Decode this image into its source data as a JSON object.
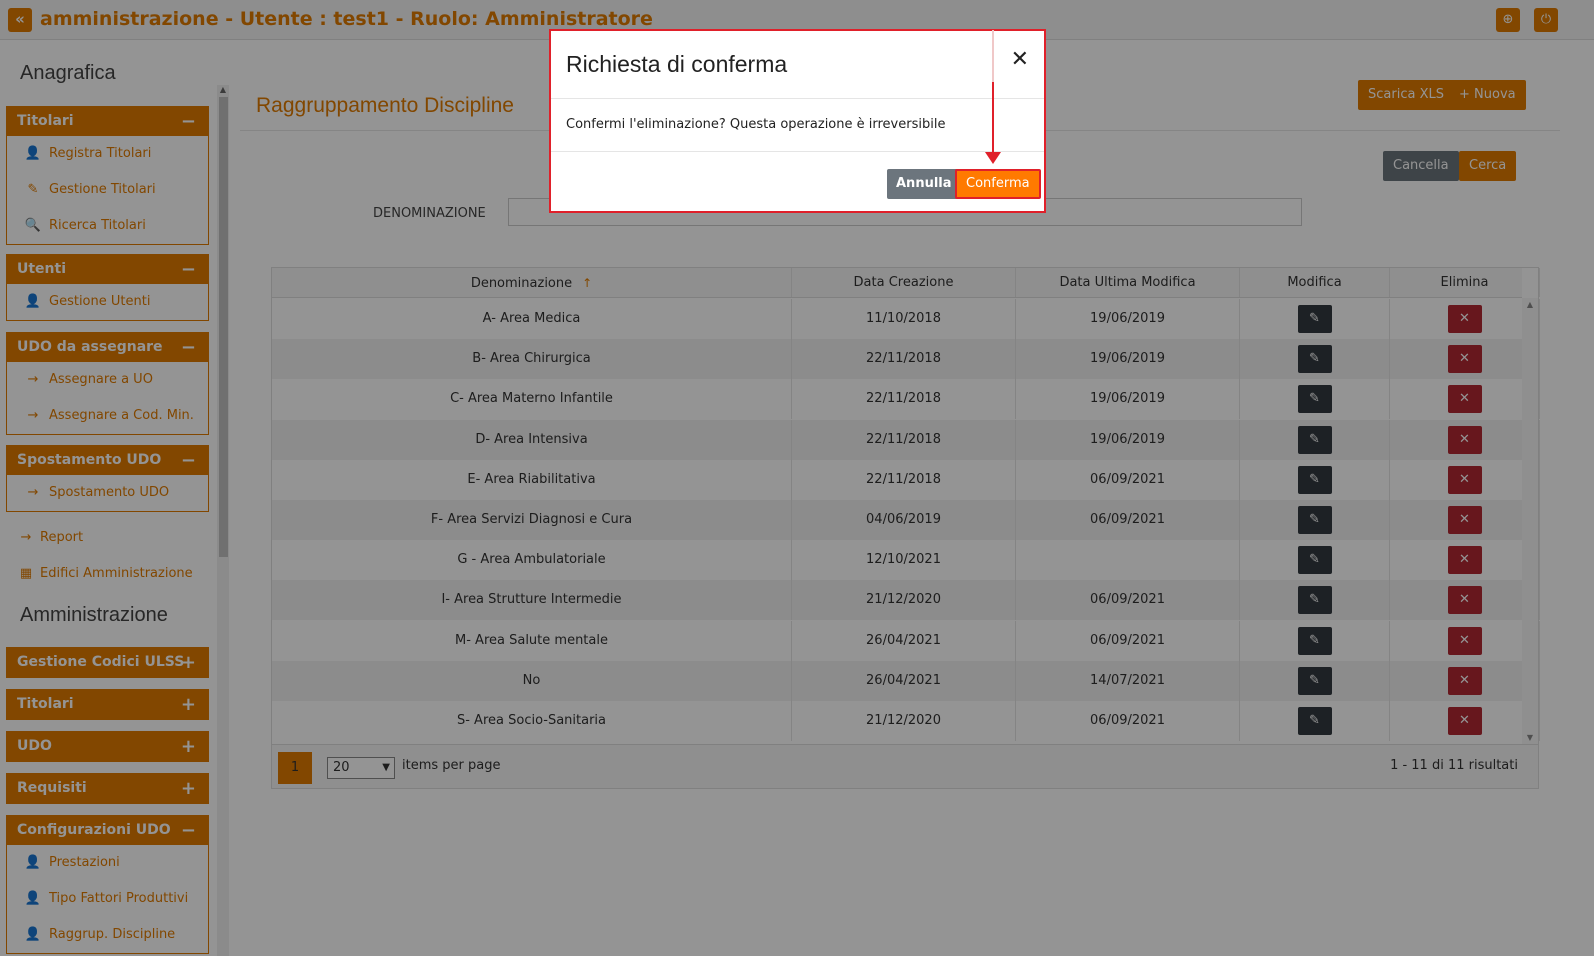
{
  "topbar": {
    "collapse_glyph": "«",
    "title": "amministrazione - Utente : test1 - Ruolo: Amministratore",
    "globe_glyph": "⊕",
    "power_glyph": "⏻"
  },
  "sidebar": {
    "heading_anagrafica": "Anagrafica",
    "heading_amministrazione": "Amministrazione",
    "panels": [
      {
        "title": "Titolari",
        "toggle": "−",
        "items": [
          {
            "label": "Registra Titolari",
            "icon": "user-plus-icon"
          },
          {
            "label": "Gestione Titolari",
            "icon": "edit-icon"
          },
          {
            "label": "Ricerca Titolari",
            "icon": "search-icon"
          }
        ]
      },
      {
        "title": "Utenti",
        "toggle": "−",
        "items": [
          {
            "label": "Gestione Utenti",
            "icon": "user-plus-icon"
          }
        ]
      },
      {
        "title": "UDO da assegnare",
        "toggle": "−",
        "items": [
          {
            "label": "Assegnare a UO",
            "icon": "arrow-right-icon"
          },
          {
            "label": "Assegnare a Cod. Min.",
            "icon": "arrow-right-icon"
          }
        ]
      },
      {
        "title": "Spostamento UDO",
        "toggle": "−",
        "items": [
          {
            "label": "Spostamento UDO",
            "icon": "arrow-right-icon"
          }
        ]
      }
    ],
    "loose_items": [
      {
        "label": "Report",
        "icon": "arrow-right-icon"
      },
      {
        "label": "Edifici Amministrazione",
        "icon": "building-icon"
      }
    ],
    "admin_panels": [
      {
        "title": "Gestione Codici ULSS",
        "toggle": "+"
      },
      {
        "title": "Titolari",
        "toggle": "+"
      },
      {
        "title": "UDO",
        "toggle": "+"
      },
      {
        "title": "Requisiti",
        "toggle": "+"
      }
    ],
    "config_panel": {
      "title": "Configurazioni UDO",
      "toggle": "−",
      "items": [
        {
          "label": "Prestazioni",
          "icon": "user-plus-icon"
        },
        {
          "label": "Tipo Fattori Produttivi",
          "icon": "user-plus-icon"
        },
        {
          "label": "Raggrup. Discipline",
          "icon": "user-plus-icon"
        }
      ]
    }
  },
  "main": {
    "page_title": "Raggruppamento Discipline",
    "export_label": "Scarica XLS",
    "new_label": "+ Nuova",
    "clear_label": "Cancella",
    "search_label": "Cerca",
    "filter_label": "DENOMINAZIONE",
    "filter_value": ""
  },
  "grid": {
    "columns": [
      "Denominazione",
      "Data Creazione",
      "Data Ultima Modifica",
      "Modifica",
      "Elimina"
    ],
    "sort_glyph": "↑",
    "edit_glyph": "✎",
    "delete_glyph": "✕",
    "rows": [
      {
        "name": "A- Area Medica",
        "created": "11/10/2018",
        "modified": "19/06/2019"
      },
      {
        "name": "B- Area Chirurgica",
        "created": "22/11/2018",
        "modified": "19/06/2019"
      },
      {
        "name": "C- Area Materno Infantile",
        "created": "22/11/2018",
        "modified": "19/06/2019"
      },
      {
        "name": "D- Area Intensiva",
        "created": "22/11/2018",
        "modified": "19/06/2019"
      },
      {
        "name": "E- Area Riabilitativa",
        "created": "22/11/2018",
        "modified": "06/09/2021"
      },
      {
        "name": "F- Area Servizi Diagnosi e Cura",
        "created": "04/06/2019",
        "modified": "06/09/2021"
      },
      {
        "name": "G - Area Ambulatoriale",
        "created": "12/10/2021",
        "modified": ""
      },
      {
        "name": "I- Area Strutture Intermedie",
        "created": "21/12/2020",
        "modified": "06/09/2021"
      },
      {
        "name": "M- Area Salute mentale",
        "created": "26/04/2021",
        "modified": "06/09/2021"
      },
      {
        "name": "No",
        "created": "26/04/2021",
        "modified": "14/07/2021"
      },
      {
        "name": "S- Area Socio-Sanitaria",
        "created": "21/12/2020",
        "modified": "06/09/2021"
      }
    ],
    "pager": {
      "current_page": "1",
      "page_size": "20",
      "per_page_label": "items per page",
      "results": "1 - 11 di 11 risultati"
    }
  },
  "modal": {
    "title": "Richiesta di conferma",
    "close_glyph": "✕",
    "message": "Confermi l'eliminazione? Questa operazione è irreversibile",
    "cancel_label": "Annulla",
    "confirm_label": "Conferma"
  },
  "colors": {
    "accent": "#e07b00",
    "danger": "#b22832",
    "highlight": "#e0202a"
  }
}
